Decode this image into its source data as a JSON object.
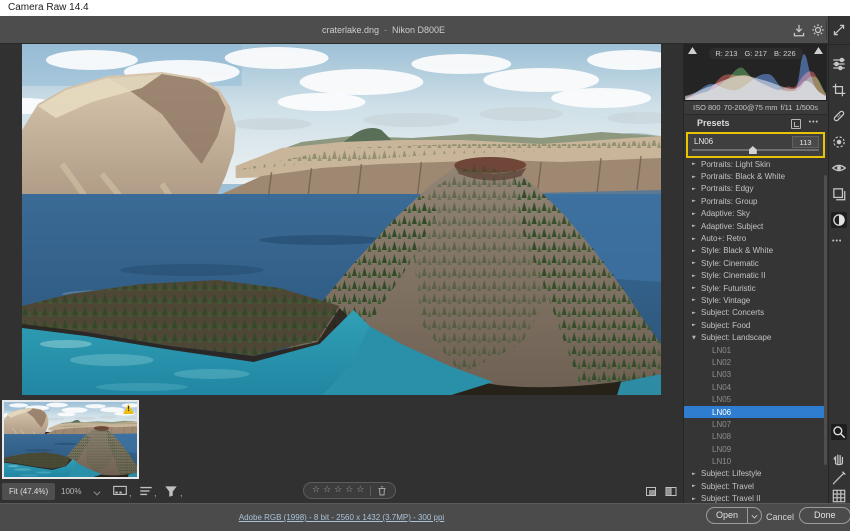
{
  "titlebar": {
    "title": "Camera Raw 14.4"
  },
  "header": {
    "document": "craterlake.dng",
    "dash": "-",
    "camera": "Nikon D800E"
  },
  "histogram": {
    "r": "R: 213",
    "g": "G: 217",
    "b": "B: 226"
  },
  "capture": {
    "iso": "ISO 800",
    "lens": "70-200@75 mm",
    "aperture": "f/11",
    "shutter": "1/500s"
  },
  "presets": {
    "title": "Presets",
    "slider": {
      "label": "LN06",
      "value": "113"
    },
    "items": [
      {
        "label": "Portraits: Light Skin",
        "type": "group",
        "state": "collapsed"
      },
      {
        "label": "Portraits: Black & White",
        "type": "group",
        "state": "collapsed"
      },
      {
        "label": "Portraits: Edgy",
        "type": "group",
        "state": "collapsed"
      },
      {
        "label": "Portraits: Group",
        "type": "group",
        "state": "collapsed"
      },
      {
        "label": "Adaptive: Sky",
        "type": "group",
        "state": "collapsed"
      },
      {
        "label": "Adaptive: Subject",
        "type": "group",
        "state": "collapsed"
      },
      {
        "label": "Auto+: Retro",
        "type": "group",
        "state": "collapsed"
      },
      {
        "label": "Style: Black & White",
        "type": "group",
        "state": "collapsed"
      },
      {
        "label": "Style: Cinematic",
        "type": "group",
        "state": "collapsed"
      },
      {
        "label": "Style: Cinematic II",
        "type": "group",
        "state": "collapsed"
      },
      {
        "label": "Style: Futuristic",
        "type": "group",
        "state": "collapsed"
      },
      {
        "label": "Style: Vintage",
        "type": "group",
        "state": "collapsed"
      },
      {
        "label": "Subject: Concerts",
        "type": "group",
        "state": "collapsed"
      },
      {
        "label": "Subject: Food",
        "type": "group",
        "state": "collapsed"
      },
      {
        "label": "Subject: Landscape",
        "type": "group",
        "state": "expanded"
      },
      {
        "label": "LN01",
        "type": "preset"
      },
      {
        "label": "LN02",
        "type": "preset"
      },
      {
        "label": "LN03",
        "type": "preset"
      },
      {
        "label": "LN04",
        "type": "preset"
      },
      {
        "label": "LN05",
        "type": "preset"
      },
      {
        "label": "LN06",
        "type": "preset",
        "selected": true
      },
      {
        "label": "LN07",
        "type": "preset"
      },
      {
        "label": "LN08",
        "type": "preset"
      },
      {
        "label": "LN09",
        "type": "preset"
      },
      {
        "label": "LN10",
        "type": "preset"
      },
      {
        "label": "Subject: Lifestyle",
        "type": "group",
        "state": "collapsed"
      },
      {
        "label": "Subject: Travel",
        "type": "group",
        "state": "collapsed"
      },
      {
        "label": "Subject: Travel II",
        "type": "group",
        "state": "collapsed"
      }
    ]
  },
  "zoombar": {
    "fit": "Fit (47.4%)",
    "hundred": "100%"
  },
  "rating": {
    "count": 5
  },
  "bottombar": {
    "image_info": "Adobe RGB (1998) - 8 bit - 2560 x 1432 (3.7MP) - 300 ppi",
    "open": "Open",
    "cancel": "Cancel",
    "done": "Done"
  },
  "icons": {
    "triangle_collapsed": "►",
    "triangle_expanded": "▼",
    "star": "☆",
    "more_dots": "•••",
    "scroll_up": "▲",
    "scroll_down": "▼",
    "warning": "!"
  },
  "colors": {
    "selection_blue": "#2e7dd1",
    "highlight_yellow": "#e9c400"
  }
}
